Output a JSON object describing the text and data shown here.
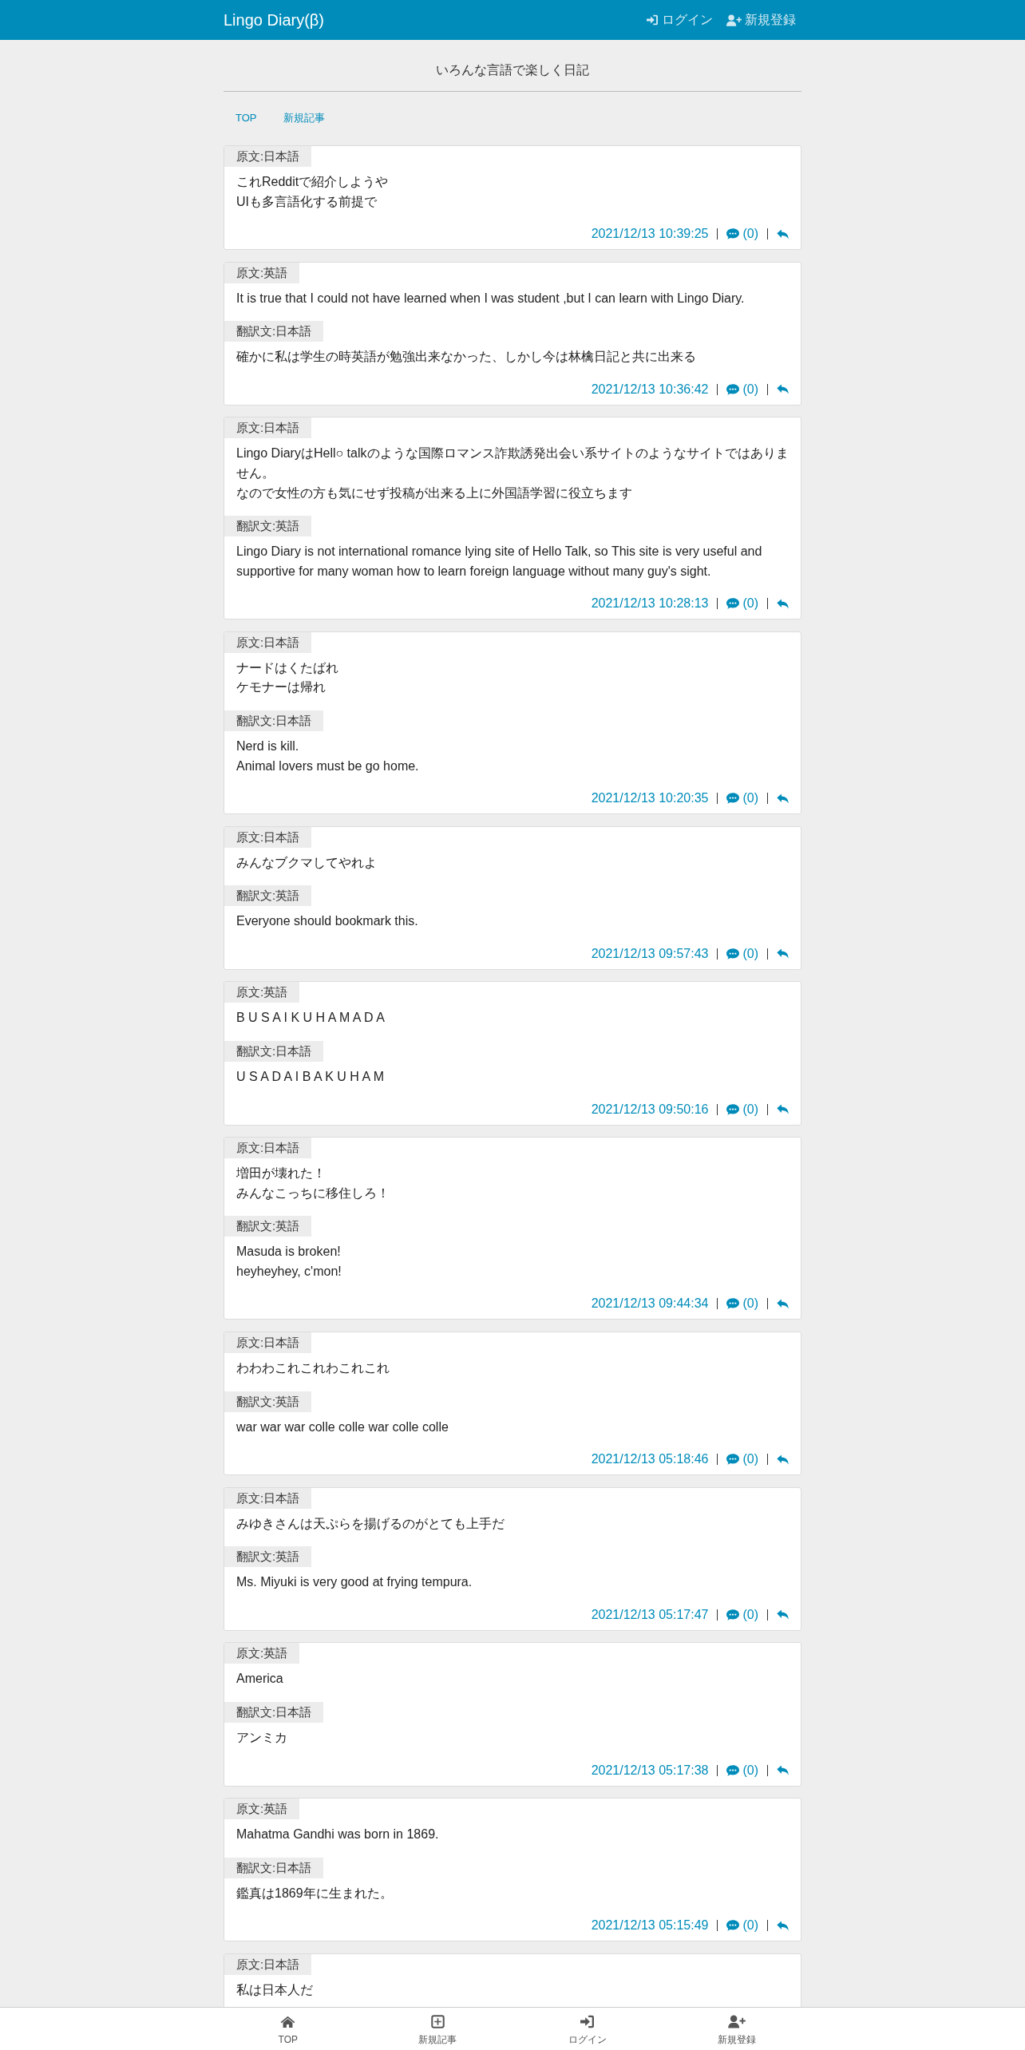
{
  "header": {
    "title": "Lingo Diary(β)",
    "links": [
      {
        "kind": "login",
        "label": "ログイン"
      },
      {
        "kind": "signup",
        "label": "新規登録"
      }
    ]
  },
  "tagline": "いろんな言語で楽しく日記",
  "nav_links": [
    {
      "label": "TOP"
    },
    {
      "label": "新規記事"
    }
  ],
  "posts": [
    {
      "sections": [
        {
          "label": "原文:日本語",
          "lines": [
            "これRedditで紹介しようや",
            "UIも多言語化する前提で"
          ]
        }
      ],
      "timestamp": "2021/12/13 10:39:25",
      "comments": "(0)"
    },
    {
      "sections": [
        {
          "label": "原文:英語",
          "lines": [
            "It is true that I could not have learned when I was student ,but I can learn with Lingo Diary."
          ]
        },
        {
          "label": "翻訳文:日本語",
          "lines": [
            "確かに私は学生の時英語が勉強出来なかった、しかし今は林檎日記と共に出来る"
          ]
        }
      ],
      "timestamp": "2021/12/13 10:36:42",
      "comments": "(0)"
    },
    {
      "sections": [
        {
          "label": "原文:日本語",
          "lines": [
            "Lingo DiaryはHell○ talkのような国際ロマンス詐欺誘発出会い系サイトのようなサイトではありません。",
            "なので女性の方も気にせず投稿が出来る上に外国語学習に役立ちます"
          ]
        },
        {
          "label": "翻訳文:英語",
          "lines": [
            "Lingo Diary is not international romance lying site of Hello Talk, so This site is very useful and supportive for many woman how to learn foreign language without many guy's sight."
          ]
        }
      ],
      "timestamp": "2021/12/13 10:28:13",
      "comments": "(0)"
    },
    {
      "sections": [
        {
          "label": "原文:日本語",
          "lines": [
            "ナードはくたばれ",
            "ケモナーは帰れ"
          ]
        },
        {
          "label": "翻訳文:日本語",
          "lines": [
            "Nerd is kill.",
            "Animal lovers must be go home."
          ]
        }
      ],
      "timestamp": "2021/12/13 10:20:35",
      "comments": "(0)"
    },
    {
      "sections": [
        {
          "label": "原文:日本語",
          "lines": [
            "みんなブクマしてやれよ"
          ]
        },
        {
          "label": "翻訳文:英語",
          "lines": [
            "Everyone should bookmark this."
          ]
        }
      ],
      "timestamp": "2021/12/13 09:57:43",
      "comments": "(0)"
    },
    {
      "sections": [
        {
          "label": "原文:英語",
          "lines": [
            "B U S A I K U H A M A D A"
          ]
        },
        {
          "label": "翻訳文:日本語",
          "lines": [
            "U S A D A I B A K U H A M"
          ]
        }
      ],
      "timestamp": "2021/12/13 09:50:16",
      "comments": "(0)"
    },
    {
      "sections": [
        {
          "label": "原文:日本語",
          "lines": [
            "増田が壊れた！",
            "みんなこっちに移住しろ！"
          ]
        },
        {
          "label": "翻訳文:英語",
          "lines": [
            "Masuda is broken!",
            "heyheyhey, c'mon!"
          ]
        }
      ],
      "timestamp": "2021/12/13 09:44:34",
      "comments": "(0)"
    },
    {
      "sections": [
        {
          "label": "原文:日本語",
          "lines": [
            "わわわこれこれわこれこれ"
          ]
        },
        {
          "label": "翻訳文:英語",
          "lines": [
            "war war war colle colle war colle colle"
          ]
        }
      ],
      "timestamp": "2021/12/13 05:18:46",
      "comments": "(0)"
    },
    {
      "sections": [
        {
          "label": "原文:日本語",
          "lines": [
            "みゆきさんは天ぷらを揚げるのがとても上手だ"
          ]
        },
        {
          "label": "翻訳文:英語",
          "lines": [
            "Ms. Miyuki is very good at frying tempura."
          ]
        }
      ],
      "timestamp": "2021/12/13 05:17:47",
      "comments": "(0)"
    },
    {
      "sections": [
        {
          "label": "原文:英語",
          "lines": [
            "America"
          ]
        },
        {
          "label": "翻訳文:日本語",
          "lines": [
            "アンミカ"
          ]
        }
      ],
      "timestamp": "2021/12/13 05:17:38",
      "comments": "(0)"
    },
    {
      "sections": [
        {
          "label": "原文:英語",
          "lines": [
            "Mahatma Gandhi was born in 1869."
          ]
        },
        {
          "label": "翻訳文:日本語",
          "lines": [
            "鑑真は1869年に生まれた。"
          ]
        }
      ],
      "timestamp": "2021/12/13 05:15:49",
      "comments": "(0)"
    },
    {
      "sections": [
        {
          "label": "原文:日本語",
          "lines": [
            "私は日本人だ"
          ]
        }
      ]
    }
  ],
  "bottom_nav": [
    {
      "kind": "home",
      "label": "TOP"
    },
    {
      "kind": "compose",
      "label": "新規記事"
    },
    {
      "kind": "login",
      "label": "ログイン"
    },
    {
      "kind": "signup",
      "label": "新規登録"
    }
  ]
}
